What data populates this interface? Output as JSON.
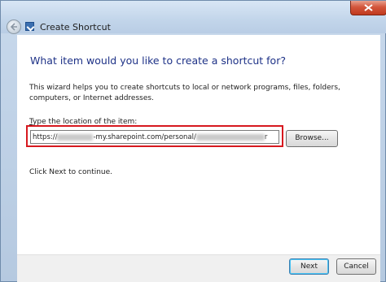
{
  "window": {
    "title": "Create Shortcut"
  },
  "main": {
    "heading": "What item would you like to create a shortcut for?",
    "description": "This wizard helps you to create shortcuts to local or network programs, files, folders, computers, or Internet addresses.",
    "location_label_prefix": "T",
    "location_label_rest": "ype the location of the item:",
    "location_value_start": "https://",
    "location_value_middle": "-my.sharepoint.com/personal/",
    "location_value_end": "r",
    "browse_label": "Browse...",
    "continue_text": "Click Next to continue."
  },
  "footer": {
    "next_label": "Next",
    "cancel_label": "Cancel"
  },
  "colors": {
    "heading": "#1e3287",
    "highlight": "#d7191f",
    "close_button": "#c0391d"
  },
  "icons": [
    "back-arrow-icon",
    "wizard-icon",
    "close-icon"
  ]
}
